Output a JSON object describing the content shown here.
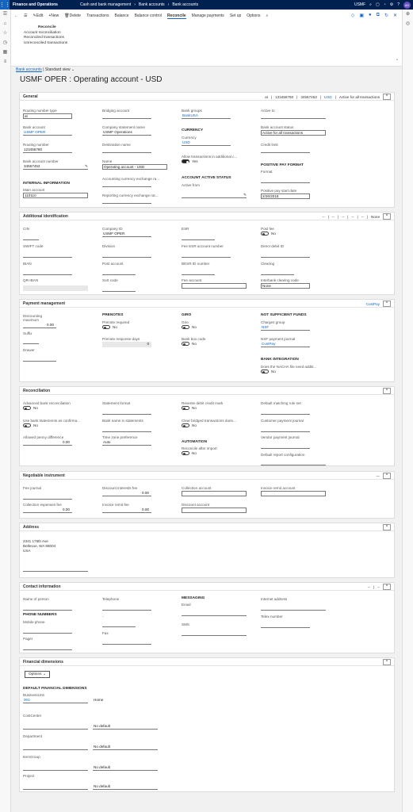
{
  "topbar": {
    "app": "Finance and Operations",
    "crumbs": [
      "Cash and bank management",
      "Bank accounts",
      "Bank accounts"
    ],
    "company": "USMF",
    "avatar": "AD"
  },
  "actionpane": {
    "items": [
      "Edit",
      "New",
      "Delete",
      "Transactions",
      "Balance",
      "Balance control",
      "Reconcile",
      "Manage payments",
      "Set up",
      "Options"
    ],
    "selected": "Reconcile",
    "group_title": "Reconcile",
    "group_items": [
      "Account reconciliation",
      "Reconciled transactions",
      "Unreconciled transactions"
    ]
  },
  "page": {
    "breadcrumb": "Bank accounts",
    "view": "Standard view",
    "title": "USMF OPER : Operating account - USD"
  },
  "general": {
    "title": "General",
    "summary": [
      "at",
      "123456780",
      "34567453",
      "USD",
      "Active for all transactions"
    ],
    "routing_type_label": "Routing number type",
    "routing_type": "at",
    "bank_account_label": "Bank account",
    "bank_account": "USMF OPER",
    "routing_number_label": "Routing number",
    "routing_number": "123456780",
    "bank_acct_number_label": "Bank account number",
    "bank_acct_number": "34567453",
    "internal_info": "INTERNAL INFORMATION",
    "main_account_label": "Main account",
    "main_account": "110110",
    "bridging_label": "Bridging account",
    "company_stmt_label": "Company statement name",
    "company_stmt": "USMF Operations",
    "destination_label": "Destination name",
    "name_label": "Name",
    "name": "Operating account - USD",
    "acct_curr_label": "Accounting currency exchange ra...",
    "rep_curr_label": "Reporting currency exchange rat...",
    "bank_groups_label": "Bank groups",
    "bank_groups": "BankUSA",
    "currency_section": "CURRENCY",
    "currency_label": "Currency",
    "currency": "USD",
    "allow_label": "Allow transactions in additional c...",
    "allow_value": "Yes",
    "active_status": "ACCOUNT ACTIVE STATUS",
    "active_from_label": "Active from",
    "active_to_label": "Active to",
    "status_label": "Bank account status",
    "status": "Active for all transactions",
    "credit_label": "Credit limit",
    "ppf_section": "POSITIVE PAY FORMAT",
    "format_label": "Format",
    "ppdate_label": "Positive pay start date",
    "ppdate": "2/26/2018"
  },
  "addl": {
    "title": "Additional identification",
    "summary": [
      "--",
      "--",
      "--",
      "--",
      "--",
      "None"
    ],
    "cin": "CIN",
    "swift": "SWIFT code",
    "iban": "IBAN",
    "qriban": "QR-IBAN",
    "company_id_label": "Company ID",
    "company_id": "USMF OPER",
    "division": "Division",
    "post_account": "Post account",
    "sort_code": "Sort code",
    "esr": "ESR",
    "fee_esr": "Fee ESR account number",
    "besr": "BESR ID number",
    "fee_account": "Fee account",
    "post_fee_label": "Post fee",
    "post_fee": "No",
    "direct_debit": "Direct debit ID",
    "clearing": "Clearing",
    "interbank_label": "Interbank clearing code",
    "interbank": "None"
  },
  "payment": {
    "title": "Payment management",
    "summary": "CustPay",
    "disc_max_label": "Discounting maximum",
    "disc_max": "0.00",
    "suffix": "Suffix",
    "drawer": "Drawer",
    "prenotes": "PRENOTES",
    "prenote_req_label": "Prenote required",
    "prenote_req": "No",
    "prenote_days_label": "Prenote response days",
    "prenote_days": "0",
    "giro": "GIRO",
    "giro_label": "Giro",
    "giro_val": "No",
    "bankbox_label": "Bank box code",
    "bankbox": "No",
    "nsf": "NOT SUFFICIENT FUNDS",
    "charges_label": "Charges group",
    "charges": "NSF",
    "nsf_journal_label": "NSF payment journal",
    "nsf_journal": "CustPay",
    "bank_int": "BANK INTEGRATION",
    "nacha_label": "Does the NACHA file need additi...",
    "nacha": "No"
  },
  "recon": {
    "title": "Reconciliation",
    "adv_label": "Advanced bank reconciliation",
    "adv": "No",
    "use_stmt_label": "Use bank statements as confirma...",
    "use_stmt": "No",
    "penny_label": "Allowed penny difference",
    "penny": "0.00",
    "stmt_format": "Statement format",
    "bank_name_stmt": "Bank name in statements",
    "tz_label": "Time zone preference",
    "tz": "Auto",
    "rev_debit_label": "Reverse debit credit mark",
    "rev_debit": "No",
    "clear_bridged_label": "Clear bridged transactions durin...",
    "clear_bridged": "No",
    "automation": "AUTOMATION",
    "recon_import_label": "Reconcile after import",
    "recon_import": "No",
    "matching_rule": "Default matching rule set",
    "cust_journal": "Customer payment journal",
    "vend_journal": "Vendor payment journal",
    "report_config": "Default report configuration"
  },
  "nego": {
    "title": "Negotiable instrument",
    "fee_journal": "Fee journal",
    "coll_exp_label": "Collection expenses fee",
    "coll_exp": "0.00",
    "disc_int_label": "Discount interests fee",
    "disc_int": "0.00",
    "inv_remit_fee_label": "Invoice remit fee",
    "inv_remit_fee": "0.00",
    "coll_account": "Collection account",
    "disc_account": "Discount account",
    "inv_remit_account": "Invoice remit account"
  },
  "address": {
    "title": "Address",
    "lines": [
      "2341 176th Ave",
      "Bellevue, WA 98004",
      "USA"
    ]
  },
  "contact": {
    "title": "Contact information",
    "summary": [
      "--",
      "--"
    ],
    "person": "Name of person",
    "phone_numbers": "PHONE NUMBERS",
    "mobile": "Mobile phone",
    "pager": "Pager",
    "telephone": "Telephone",
    "dash": "-",
    "fax": "Fax",
    "messaging": "MESSAGING",
    "email": "Email",
    "sms": "SMS",
    "internet": "Internet address",
    "telex": "Telex number"
  },
  "fin": {
    "title": "Financial dimensions",
    "options": "Options",
    "section": "DEFAULT FINANCIAL DIMENSIONS",
    "dims": [
      {
        "label": "BusinessUnit",
        "value": "001",
        "desc": "Home"
      },
      {
        "label": "CostCenter",
        "value": "",
        "desc": "No default"
      },
      {
        "label": "Department",
        "value": "",
        "desc": "No default"
      },
      {
        "label": "ItemGroup",
        "value": "",
        "desc": "No default"
      },
      {
        "label": "Project",
        "value": "",
        "desc": "No default"
      }
    ]
  }
}
